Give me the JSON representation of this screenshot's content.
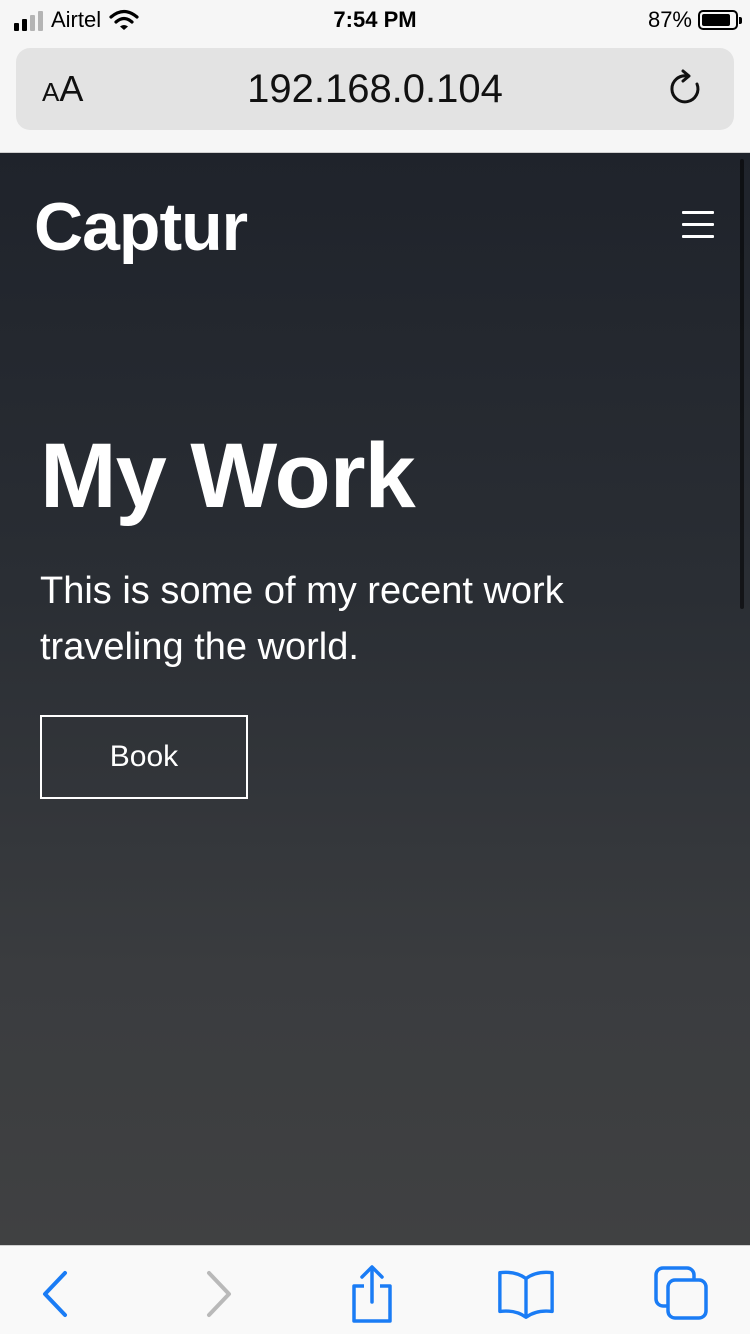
{
  "status_bar": {
    "carrier": "Airtel",
    "time": "7:54 PM",
    "battery_percent": "87%",
    "battery_level": 0.87,
    "signal_bars_active": 2,
    "signal_bars_total": 4,
    "icons": [
      "signal-icon",
      "wifi-icon",
      "battery-icon"
    ]
  },
  "browser": {
    "text_size_label_small": "A",
    "text_size_label_large": "A",
    "url": "192.168.0.104",
    "icons": [
      "reload-icon"
    ]
  },
  "site": {
    "logo": "Captur",
    "menu_icon": "hamburger-menu-icon",
    "hero_title": "My Work",
    "hero_text": "This is some of my recent work traveling the world.",
    "cta_label": "Book"
  },
  "toolbar": {
    "icons": [
      "back-icon",
      "forward-icon",
      "share-icon",
      "bookmarks-icon",
      "tabs-icon"
    ],
    "accent": "#1a7cf5",
    "disabled": "#b9b9b9"
  },
  "colors": {
    "page_top": "#1f232b",
    "page_bottom": "#404142",
    "text_on_dark": "#ffffff"
  }
}
